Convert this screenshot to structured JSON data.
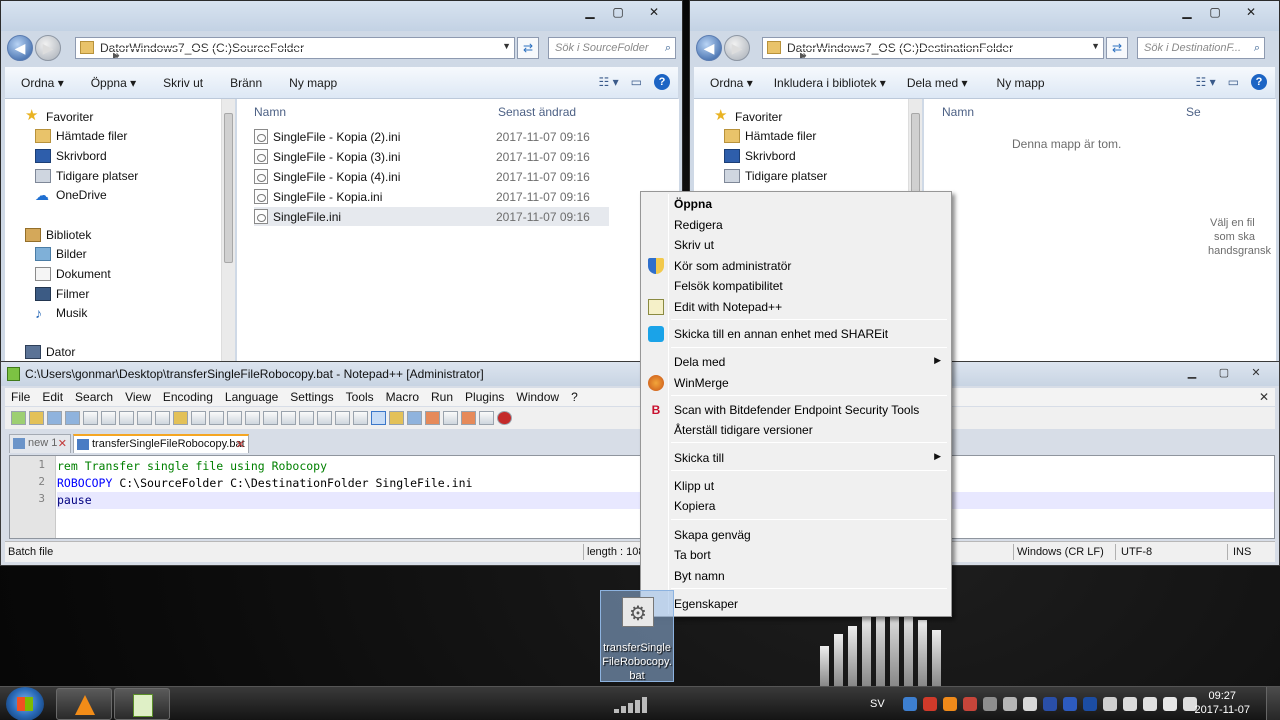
{
  "left_window": {
    "address": [
      "Dator",
      "Windows7_OS (C:)",
      "SourceFolder"
    ],
    "search_placeholder": "Sök i SourceFolder",
    "commands": [
      "Ordna",
      "Öppna",
      "Skriv ut",
      "Bränn",
      "Ny mapp"
    ],
    "nav": {
      "favorites": "Favoriter",
      "downloads": "Hämtade filer",
      "desktop": "Skrivbord",
      "recent": "Tidigare platser",
      "onedrive": "OneDrive",
      "libraries": "Bibliotek",
      "pictures": "Bilder",
      "documents": "Dokument",
      "movies": "Filmer",
      "music": "Musik",
      "computer": "Dator"
    },
    "columns": {
      "name": "Namn",
      "modified": "Senast ändrad"
    },
    "files": [
      {
        "name": "SingleFile - Kopia (2).ini",
        "date": "2017-11-07 09:16"
      },
      {
        "name": "SingleFile - Kopia (3).ini",
        "date": "2017-11-07 09:16"
      },
      {
        "name": "SingleFile - Kopia (4).ini",
        "date": "2017-11-07 09:16"
      },
      {
        "name": "SingleFile - Kopia.ini",
        "date": "2017-11-07 09:16"
      },
      {
        "name": "SingleFile.ini",
        "date": "2017-11-07 09:16"
      }
    ]
  },
  "right_window": {
    "address": [
      "Dator",
      "Windows7_OS (C:)",
      "DestinationFolder"
    ],
    "search_placeholder": "Sök i DestinationF...",
    "commands": [
      "Ordna",
      "Inkludera i bibliotek",
      "Dela med",
      "Ny mapp"
    ],
    "nav": {
      "favorites": "Favoriter",
      "downloads": "Hämtade filer",
      "desktop": "Skrivbord",
      "recent": "Tidigare platser"
    },
    "columns": {
      "name": "Namn",
      "modified": "Se"
    },
    "empty_text": "Denna mapp är tom.",
    "preview_text": [
      "Välj en fil",
      "som ska",
      "handsgransk"
    ]
  },
  "notepad": {
    "title": "C:\\Users\\gonmar\\Desktop\\transferSingleFileRobocopy.bat - Notepad++ [Administrator]",
    "menu": [
      "File",
      "Edit",
      "Search",
      "View",
      "Encoding",
      "Language",
      "Settings",
      "Tools",
      "Macro",
      "Run",
      "Plugins",
      "Window",
      "?"
    ],
    "tabs": [
      "new 1",
      "transferSingleFileRobocopy.bat"
    ],
    "lines": [
      {
        "num": "1",
        "tokens": [
          {
            "t": "rem Transfer single file using Robocopy",
            "c": "cm"
          }
        ]
      },
      {
        "num": "2",
        "tokens": [
          {
            "t": "ROBOCOPY",
            "c": "kw"
          },
          {
            "t": " C:\\SourceFolder C:\\DestinationFolder SingleFile.ini",
            "c": "pl"
          }
        ]
      },
      {
        "num": "3",
        "tokens": [
          {
            "t": "pause",
            "c": "kw2"
          }
        ]
      }
    ],
    "status": {
      "type": "Batch file",
      "length": "length : 108",
      "eol": "Windows (CR LF)",
      "encoding": "UTF-8",
      "mode": "INS"
    }
  },
  "context_menu": {
    "items": [
      {
        "label": "Öppna",
        "bold": true
      },
      {
        "label": "Redigera"
      },
      {
        "label": "Skriv ut"
      },
      {
        "label": "Kör som administratör",
        "icon": "uac-shield-icon"
      },
      {
        "label": "Felsök kompatibilitet"
      },
      {
        "label": "Edit with Notepad++",
        "icon": "notepad-plus-plus-icon"
      },
      {
        "label": "Skicka till en annan enhet med SHAREit",
        "icon": "shareit-icon"
      },
      {
        "label": "Dela med",
        "submenu": true
      },
      {
        "label": "WinMerge",
        "icon": "winmerge-icon"
      },
      {
        "label": "Scan with Bitdefender Endpoint Security Tools",
        "icon": "bitdefender-icon"
      },
      {
        "label": "Återställ tidigare versioner"
      },
      {
        "label": "Skicka till",
        "submenu": true
      },
      {
        "label": "Klipp ut"
      },
      {
        "label": "Kopiera"
      },
      {
        "label": "Skapa genväg"
      },
      {
        "label": "Ta bort"
      },
      {
        "label": "Byt namn"
      },
      {
        "label": "Egenskaper"
      }
    ]
  },
  "desktop_icon": {
    "label": "transferSingleFileRobocopy.bat"
  },
  "taskbar": {
    "language": "SV",
    "time": "09:27",
    "date": "2017-11-07"
  }
}
